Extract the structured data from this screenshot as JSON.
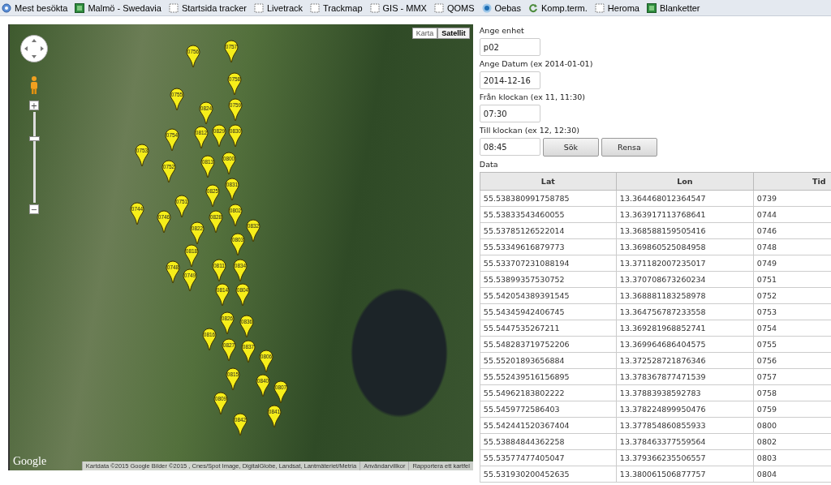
{
  "bookmarks": [
    {
      "label": "Mest besökta",
      "kind": "star"
    },
    {
      "label": "Malmö - Swedavia",
      "kind": "site"
    },
    {
      "label": "Startsida tracker",
      "kind": "page"
    },
    {
      "label": "Livetrack",
      "kind": "page"
    },
    {
      "label": "Trackmap",
      "kind": "page"
    },
    {
      "label": "GIS - MMX",
      "kind": "page"
    },
    {
      "label": "QOMS",
      "kind": "page"
    },
    {
      "label": "Oebas",
      "kind": "dot"
    },
    {
      "label": "Komp.term.",
      "kind": "refresh"
    },
    {
      "label": "Heroma",
      "kind": "page"
    },
    {
      "label": "Blanketter",
      "kind": "site"
    }
  ],
  "map": {
    "map_types": [
      {
        "label": "Karta",
        "selected": false
      },
      {
        "label": "Satellit",
        "selected": true
      }
    ],
    "zoom_in": "+",
    "zoom_out": "−",
    "zoom_slider": {
      "level": 0.72
    },
    "pins": [
      {
        "label": "0756"
      },
      {
        "label": "0757"
      },
      {
        "label": "0758"
      },
      {
        "label": "0755"
      },
      {
        "label": "0824"
      },
      {
        "label": "0759"
      },
      {
        "label": "0812"
      },
      {
        "label": "0829"
      },
      {
        "label": "0754"
      },
      {
        "label": "0830"
      },
      {
        "label": "0753"
      },
      {
        "label": "0800"
      },
      {
        "label": "0752"
      },
      {
        "label": "0813"
      },
      {
        "label": "0831"
      },
      {
        "label": "0751"
      },
      {
        "label": "0802"
      },
      {
        "label": "0825"
      },
      {
        "label": "0744"
      },
      {
        "label": "0746"
      },
      {
        "label": "0828"
      },
      {
        "label": "0832"
      },
      {
        "label": "0822"
      },
      {
        "label": "0803"
      },
      {
        "label": "0818"
      },
      {
        "label": "0748"
      },
      {
        "label": "0749"
      },
      {
        "label": "0811"
      },
      {
        "label": "0834"
      },
      {
        "label": "0814"
      },
      {
        "label": "0804"
      },
      {
        "label": "0826"
      },
      {
        "label": "0816"
      },
      {
        "label": "0836"
      },
      {
        "label": "0827"
      },
      {
        "label": "0837"
      },
      {
        "label": "0806"
      },
      {
        "label": "0840"
      },
      {
        "label": "0815"
      },
      {
        "label": "0809"
      },
      {
        "label": "0807"
      },
      {
        "label": "0841"
      },
      {
        "label": "0842"
      }
    ],
    "logo": "Google",
    "attribution": [
      "Kartdata ©2015 Google Bilder ©2015 , Cnes/Spot Image, DigitalGlobe, Landsat, Lantmäteriet/Metria",
      "Användarvillkor",
      "Rapportera ett kartfel"
    ]
  },
  "form": {
    "fields": [
      {
        "label": "Ange enhet",
        "value": "p02"
      },
      {
        "label": "Ange Datum (ex 2014-01-01)",
        "value": "2014-12-16"
      },
      {
        "label": "Från klockan (ex 11, 11:30)",
        "value": "07:30"
      },
      {
        "label": "Till klockan (ex 12, 12:30)",
        "value": "08:45"
      }
    ],
    "buttons": [
      "Sök",
      "Rensa"
    ]
  },
  "table": {
    "title": "Data",
    "columns": [
      "Lat",
      "Lon",
      "Tid"
    ],
    "rows": [
      [
        "55.538380991758785",
        "13.364468012364547",
        "0739"
      ],
      [
        "55.53833543460055",
        "13.363917113768641",
        "0744"
      ],
      [
        "55.53785126522014",
        "13.368588159505416",
        "0746"
      ],
      [
        "55.53349616879773",
        "13.369860525084958",
        "0748"
      ],
      [
        "55.533707231088194",
        "13.371182007235017",
        "0749"
      ],
      [
        "55.53899357530752",
        "13.370708673260234",
        "0751"
      ],
      [
        "55.542054389391545",
        "13.368881183258978",
        "0752"
      ],
      [
        "55.54345942406745",
        "13.364756787233558",
        "0753"
      ],
      [
        "55.5447535267211",
        "13.369281968852741",
        "0754"
      ],
      [
        "55.548283719752206",
        "13.369964686404575",
        "0755"
      ],
      [
        "55.55201893656884",
        "13.372528721876346",
        "0756"
      ],
      [
        "55.552439516156895",
        "13.378367877471539",
        "0757"
      ],
      [
        "55.54962183802222",
        "13.37883938592783",
        "0758"
      ],
      [
        "55.5459772586403",
        "13.378224899950476",
        "0759"
      ],
      [
        "55.542441520367404",
        "13.377854860855933",
        "0800"
      ],
      [
        "55.53884844362258",
        "13.378463377559564",
        "0802"
      ],
      [
        "55.53577477405047",
        "13.379366235506557",
        "0803"
      ],
      [
        "55.531930200452635",
        "13.380061506877757",
        "0804"
      ]
    ]
  }
}
